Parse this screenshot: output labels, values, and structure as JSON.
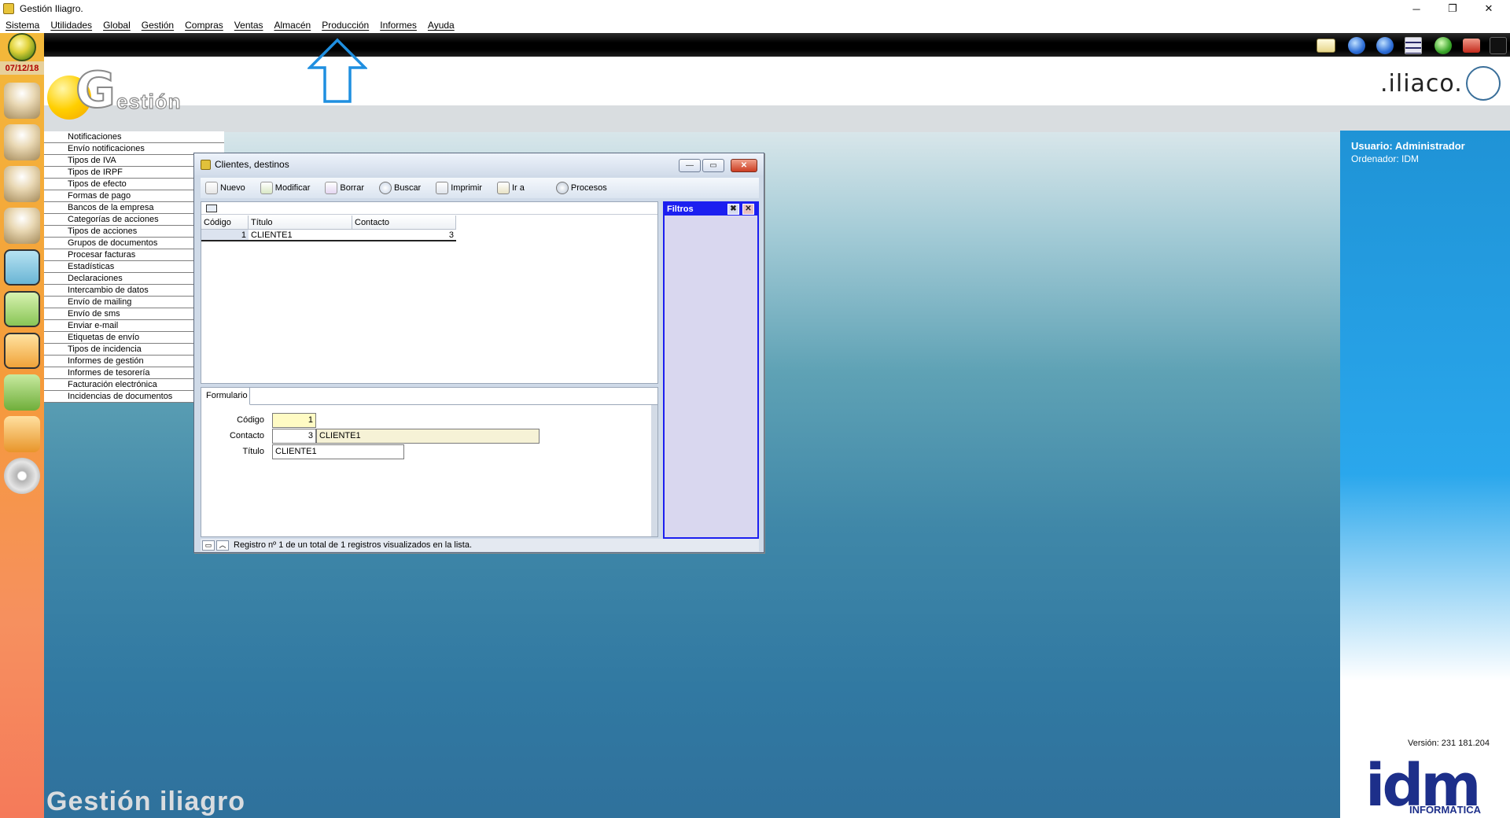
{
  "window": {
    "title": "Gestión Iliagro.",
    "controls": {
      "minimize": "─",
      "restore": "❐",
      "close": "✕"
    }
  },
  "menu": [
    "Sistema",
    "Utilidades",
    "Global",
    "Gestión",
    "Compras",
    "Ventas",
    "Almacén",
    "Producción",
    "Informes",
    "Ayuda"
  ],
  "sidebar": {
    "date": "07/12/18",
    "icons": [
      "users-icon",
      "user-icon",
      "user-p-icon",
      "user-a-icon",
      "letter-a-icon",
      "letter-f-green-icon",
      "letter-f-orange-icon",
      "green-bag-icon",
      "orange-bag-icon",
      "disc-icon"
    ]
  },
  "toolbar_icons": [
    "mail-icon",
    "back-icon",
    "forward-icon",
    "menu-icon",
    "help-icon",
    "close-icon",
    "exit-icon"
  ],
  "logo": {
    "g": "G",
    "estion": "estión",
    "iliaco": ".iliaco."
  },
  "options": [
    "Notificaciones",
    "Envío notificaciones",
    "Tipos de IVA",
    "Tipos de IRPF",
    "Tipos de efecto",
    "Formas de pago",
    "Bancos de la empresa",
    "Categorías de acciones",
    "Tipos de acciones",
    "Grupos de documentos",
    "Procesar facturas",
    "Estadísticas",
    "Declaraciones",
    "Intercambio de datos",
    "Envío de mailing",
    "Envío de sms",
    "Enviar e-mail",
    "Etiquetas de envío",
    "Tipos de incidencia",
    "Informes de gestión",
    "Informes de tesorería",
    "Facturación electrónica",
    "Incidencias de documentos"
  ],
  "dialog": {
    "title": "Clientes, destinos",
    "buttons": {
      "minimize": "—",
      "maximize": "▭",
      "close": "✕"
    },
    "toolbar": [
      "Nuevo",
      "Modificar",
      "Borrar",
      "Buscar",
      "Imprimir",
      "Ir a",
      "Procesos"
    ],
    "columns": [
      "Código",
      "Título",
      "Contacto"
    ],
    "rows": [
      {
        "codigo": "1",
        "titulo": "CLIENTE1",
        "contacto": "3"
      }
    ],
    "filters": {
      "title": "Filtros"
    },
    "tab": "Formulario",
    "form": {
      "codigo_label": "Código",
      "codigo_value": "1",
      "contacto_label": "Contacto",
      "contacto_value": "3",
      "contacto_name": "CLIENTE1",
      "titulo_label": "Título",
      "titulo_value": "CLIENTE1"
    },
    "status": "Registro nº 1 de un total de 1 registros visualizados en la lista."
  },
  "info": {
    "usuario": "Usuario: Administrador",
    "ordenador": "Ordenador: IDM",
    "version": "Versión: 231 181.204",
    "idm": "idm",
    "informatica": "INFORMÁTICA"
  },
  "footer": "Gestión iliagro",
  "colors": {
    "accent": "#1c1ff0",
    "info_panel": "#2aa7ec",
    "date_text": "#b00000"
  }
}
